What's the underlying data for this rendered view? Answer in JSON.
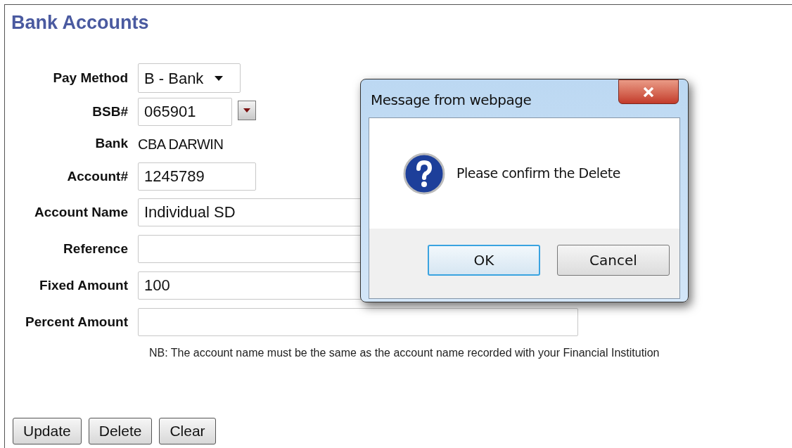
{
  "page": {
    "title": "Bank Accounts"
  },
  "fields": [
    {
      "label": "Pay Method",
      "kind": "select",
      "value": "B - Bank"
    },
    {
      "label": "BSB#",
      "kind": "lookup",
      "value": "065901"
    },
    {
      "label": "Bank",
      "kind": "static",
      "value": "CBA DARWIN"
    },
    {
      "label": "Account#",
      "kind": "short",
      "value": "1245789"
    },
    {
      "label": "Account Name",
      "kind": "long",
      "value": "Individual SD"
    },
    {
      "label": "Reference",
      "kind": "long"
    },
    {
      "label": "Fixed Amount",
      "kind": "long",
      "value": "100"
    },
    {
      "label": "Percent Amount",
      "kind": "long"
    }
  ],
  "note": "NB: The account name must be the same as the account name recorded with your Financial Institution",
  "buttons": [
    "Update",
    "Delete",
    "Clear"
  ],
  "dialog": {
    "title": "Message from webpage",
    "message": "Please confirm the Delete",
    "buttons": [
      {
        "label": "OK",
        "selected": true
      },
      {
        "label": "Cancel",
        "selected": false
      }
    ]
  }
}
